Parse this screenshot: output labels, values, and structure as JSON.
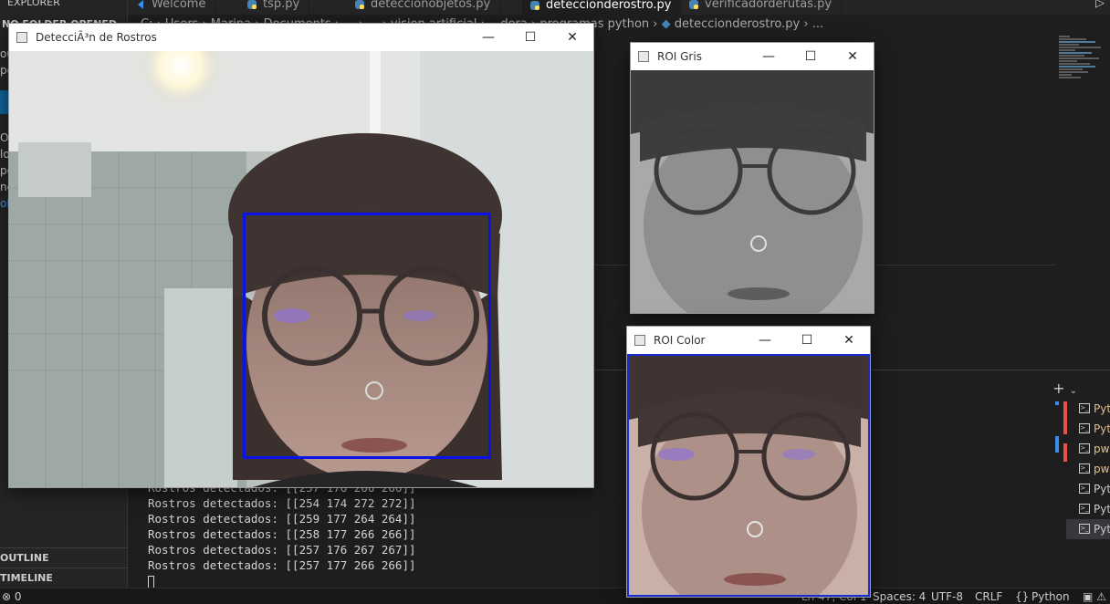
{
  "vscode": {
    "tabs": [
      {
        "label": "Welcome",
        "active": false
      },
      {
        "label": "tsp.py",
        "active": false
      },
      {
        "label": "deteccionobjetos.py",
        "active": false
      },
      {
        "label": "deteccionderostro.py",
        "active": true
      },
      {
        "label": "verificadorderutas.py",
        "active": false
      }
    ],
    "breadcrumb": {
      "left": "C: › Users › Marina › Documents › ... › ... › vision artificial › ...dora",
      "mid": "› programas python ›",
      "file": "deteccionderostro.py",
      "tail": "› ..."
    },
    "sidebar": {
      "header": "EXPLORER",
      "sub": "NO FOLDER OPENED",
      "fragments": [
        "ou",
        "pe",
        "Op",
        "lo",
        "pe",
        "ne",
        "olo"
      ],
      "outline": "OUTLINE",
      "timeline": "TIMELINE"
    },
    "terminal": {
      "lines": [
        "Rostros detectados: [[257 176 266 266]]",
        "Rostros detectados: [[254 174 272 272]]",
        "Rostros detectados: [[259 177 264 264]]",
        "Rostros detectados: [[258 177 266 266]]",
        "Rostros detectados: [[257 176 267 267]]",
        "Rostros detectados: [[257 177 266 266]]"
      ],
      "instances": [
        "Python",
        "Python",
        "pwsh",
        "pwsh",
        "Python",
        "Python",
        "Python"
      ],
      "new_terminal": "+"
    },
    "status": {
      "errors": "⊗ 0",
      "position": "Ln 47, Col 1",
      "spaces": "Spaces: 4",
      "encoding": "UTF-8",
      "eol": "CRLF",
      "braces": "{}",
      "language": "Python"
    }
  },
  "windows": {
    "main": {
      "title": "DetecciÃ³n de Rostros"
    },
    "gray": {
      "title": "ROI Gris"
    },
    "color": {
      "title": "ROI Color"
    },
    "controls": {
      "minimize": "—",
      "maximize": "☐",
      "close": "✕"
    }
  },
  "colors": {
    "accent": "#0e639c",
    "bbox": "#0a14e6",
    "python_yellow": "#e2c08d"
  }
}
